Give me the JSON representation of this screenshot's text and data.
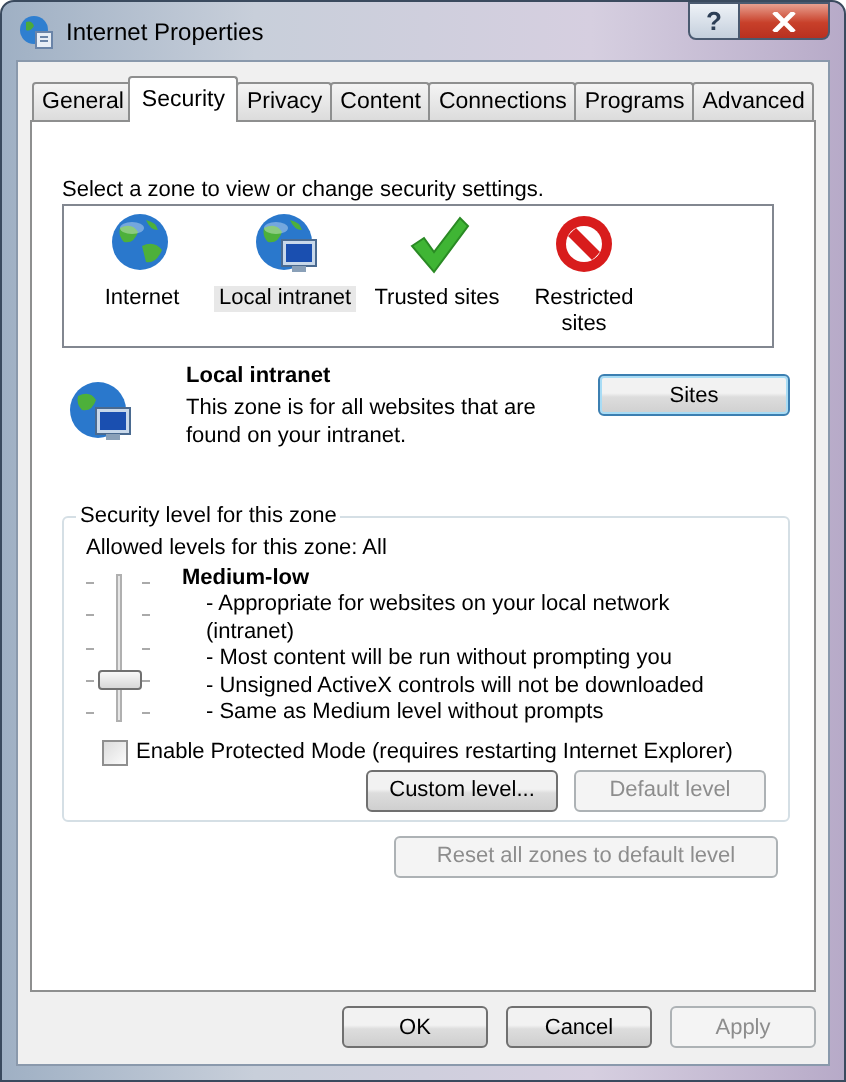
{
  "window": {
    "title": "Internet Properties",
    "help": "?"
  },
  "tabs": [
    {
      "label": "General",
      "selected": false
    },
    {
      "label": "Security",
      "selected": true
    },
    {
      "label": "Privacy",
      "selected": false
    },
    {
      "label": "Content",
      "selected": false
    },
    {
      "label": "Connections",
      "selected": false
    },
    {
      "label": "Programs",
      "selected": false
    },
    {
      "label": "Advanced",
      "selected": false
    }
  ],
  "prompt": "Select a zone to view or change security settings.",
  "zones": [
    {
      "label": "Internet",
      "kind": "globe",
      "selected": false
    },
    {
      "label": "Local intranet",
      "kind": "intranet",
      "selected": true
    },
    {
      "label": "Trusted sites",
      "kind": "trusted",
      "selected": false
    },
    {
      "label": "Restricted sites",
      "kind": "restricted",
      "selected": false
    }
  ],
  "zone_detail": {
    "kind": "intranet",
    "title": "Local intranet",
    "description": "This zone is for all websites that are found on your intranet.",
    "button": "Sites"
  },
  "security_level": {
    "legend": "Security level for this zone",
    "allowed": "Allowed levels for this zone: All",
    "level": 0.25,
    "name": "Medium-low",
    "bullets": [
      "- Appropriate for websites on your local network (intranet)",
      "- Most content will be run without prompting you",
      "- Unsigned ActiveX controls will not be downloaded",
      "- Same as Medium level without prompts"
    ],
    "protected_mode": {
      "label": "Enable Protected Mode (requires restarting Internet Explorer)",
      "checked": false
    },
    "buttons": [
      {
        "label": "Custom level...",
        "disabled": false
      },
      {
        "label": "Default level",
        "disabled": true
      }
    ]
  },
  "reset_button": {
    "label": "Reset all zones to default level",
    "disabled": true
  },
  "buttons": [
    {
      "label": "OK",
      "disabled": false
    },
    {
      "label": "Cancel",
      "disabled": false
    },
    {
      "label": "Apply",
      "disabled": true
    }
  ]
}
